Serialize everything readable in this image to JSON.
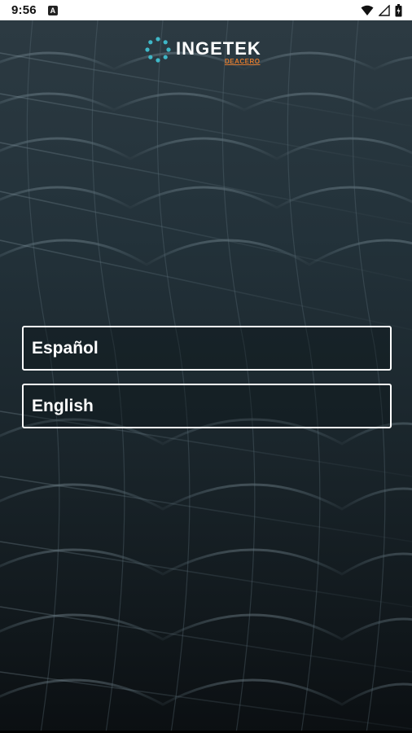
{
  "status_bar": {
    "time": "9:56",
    "notification_letter": "A",
    "icons": [
      "notification-icon",
      "wifi-icon",
      "signal-icon",
      "battery-icon"
    ]
  },
  "app": {
    "logo_text": "INGETEK",
    "logo_subtext": "DEACERO",
    "brand_color": "#3fb8c8",
    "sub_brand_color": "#e07a2e"
  },
  "language_options": [
    {
      "label": "Español"
    },
    {
      "label": "English"
    }
  ]
}
